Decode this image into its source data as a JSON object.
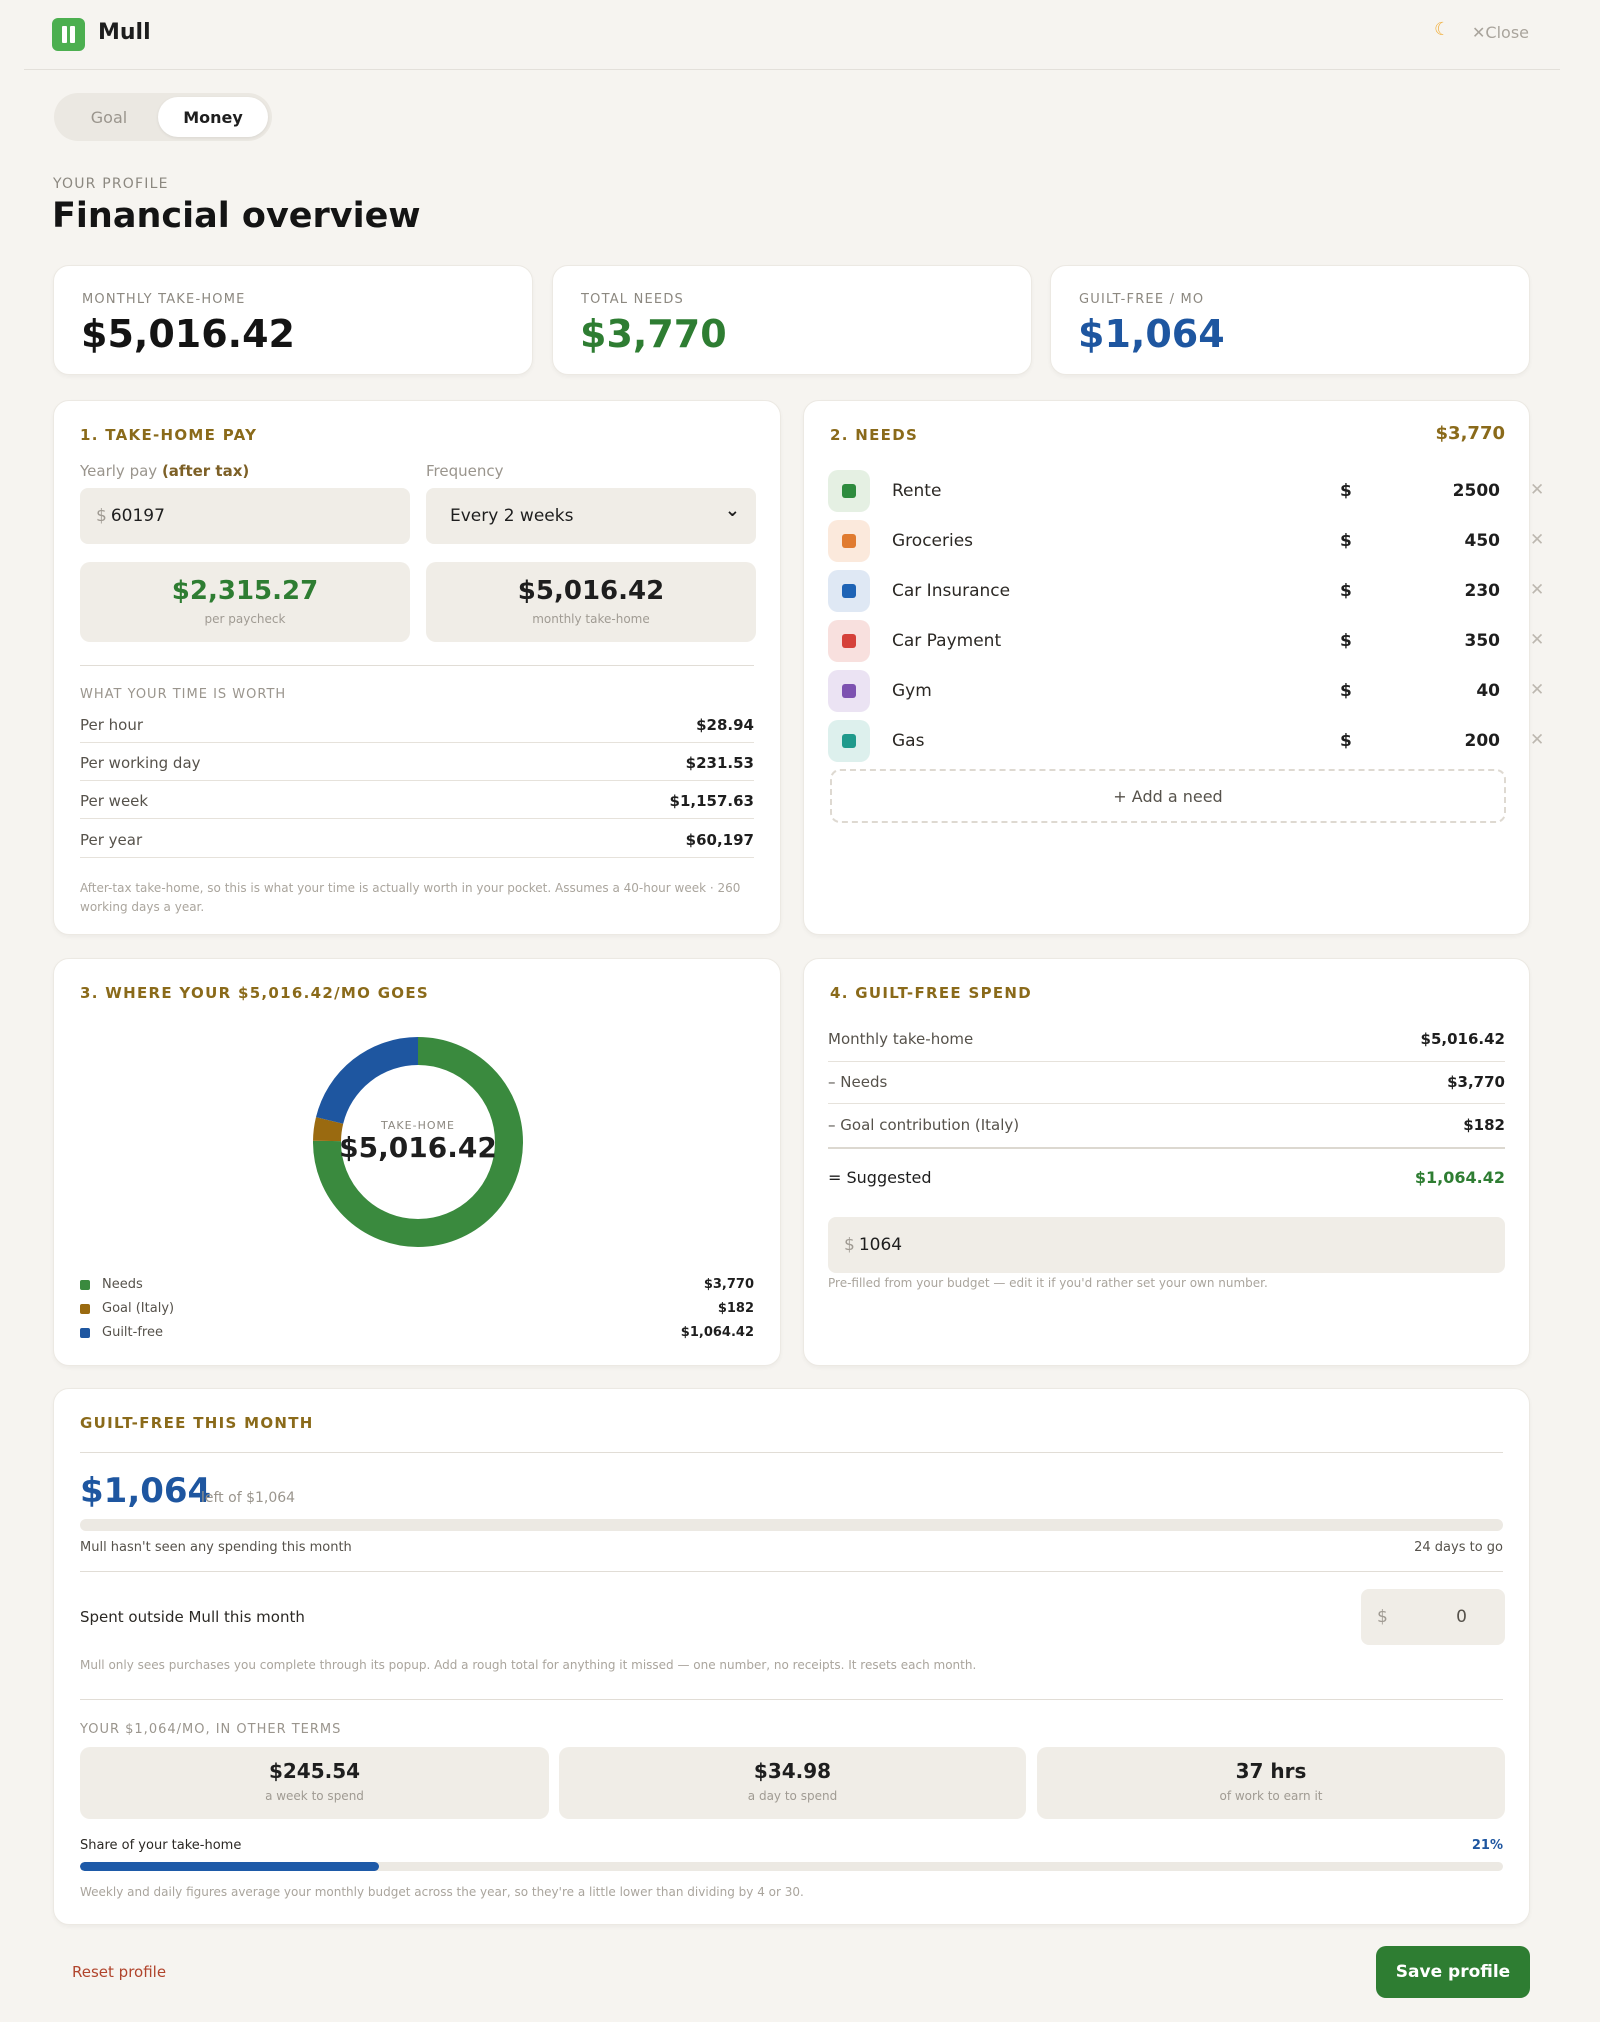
{
  "app": {
    "name": "Mull",
    "close_label": "✕Close",
    "moon_icon": "moon-icon"
  },
  "tabs": [
    {
      "label": "Goal"
    },
    {
      "label": "Money"
    }
  ],
  "header": {
    "eyebrow": "YOUR PROFILE",
    "title": "Financial overview"
  },
  "summary": [
    {
      "label": "MONTHLY TAKE-HOME",
      "value": "$5,016.42",
      "color": "#141414"
    },
    {
      "label": "TOTAL NEEDS",
      "value": "$3,770",
      "color": "#2e7d32"
    },
    {
      "label": "GUILT-FREE / MO",
      "value": "$1,064",
      "color": "#1e56a0"
    }
  ],
  "take_home": {
    "title": "1. TAKE-HOME PAY",
    "yearly_label": "Yearly pay",
    "yearly_suffix": "(after tax)",
    "yearly_prefix": "$",
    "yearly_value": "60197",
    "frequency_label": "Frequency",
    "frequency_value": "Every 2 weeks",
    "per_paycheck": {
      "value": "$2,315.27",
      "label": "per paycheck"
    },
    "monthly": {
      "value": "$5,016.42",
      "label": "monthly take-home"
    },
    "time_title": "WHAT YOUR TIME IS WORTH",
    "time_rows": [
      {
        "label": "Per hour",
        "value": "$28.94"
      },
      {
        "label": "Per working day",
        "value": "$231.53"
      },
      {
        "label": "Per week",
        "value": "$1,157.63"
      },
      {
        "label": "Per year",
        "value": "$60,197"
      }
    ],
    "note": "After-tax take-home, so this is what your time is actually worth in your pocket. Assumes a 40-hour week · 260 working days a year."
  },
  "needs": {
    "title": "2. NEEDS",
    "total": "$3,770",
    "currency": "$",
    "items": [
      {
        "name": "Rente",
        "amount": "2500",
        "color": "#2e8b3e",
        "bg": "#e5f0e3"
      },
      {
        "name": "Groceries",
        "amount": "450",
        "color": "#e07b30",
        "bg": "#fbe9dc"
      },
      {
        "name": "Car Insurance",
        "amount": "230",
        "color": "#1e63b5",
        "bg": "#dfe8f4"
      },
      {
        "name": "Car Payment",
        "amount": "350",
        "color": "#d5413a",
        "bg": "#f8e0de"
      },
      {
        "name": "Gym",
        "amount": "40",
        "color": "#7d52b0",
        "bg": "#ebe3f3"
      },
      {
        "name": "Gas",
        "amount": "200",
        "color": "#1f9a8c",
        "bg": "#ddf0ed"
      }
    ],
    "add_label": "+ Add a need"
  },
  "where": {
    "title": "3. WHERE YOUR $5,016.42/MO GOES",
    "center_label": "TAKE-HOME",
    "center_value": "$5,016.42"
  },
  "chart_data": {
    "type": "pie",
    "categories": [
      "Needs",
      "Goal (Italy)",
      "Guilt-free"
    ],
    "values": [
      3770,
      182,
      1064.42
    ],
    "value_labels": [
      "$3,770",
      "$182",
      "$1,064.42"
    ],
    "colors": [
      "#3a8a3e",
      "#9a6a10",
      "#1e56a0"
    ]
  },
  "guilt_spend": {
    "title": "4. GUILT-FREE SPEND",
    "rows": [
      {
        "label": "Monthly take-home",
        "value": "$5,016.42"
      },
      {
        "label": "– Needs",
        "value": "$3,770"
      },
      {
        "label": "– Goal contribution (Italy)",
        "value": "$182"
      }
    ],
    "suggested_label": "= Suggested",
    "suggested_value": "$1,064.42",
    "input_prefix": "$",
    "input_value": "1064",
    "note": "Pre-filled from your budget — edit it if you'd rather set your own number."
  },
  "month": {
    "title": "GUILT-FREE THIS MONTH",
    "left_value": "$1,064",
    "left_label": "left of $1,064",
    "status": "Mull hasn't seen any spending this month",
    "days_left": "24 days to go",
    "outside_label": "Spent outside Mull this month",
    "outside_prefix": "$",
    "outside_value": "0",
    "outside_note": "Mull only sees purchases you complete through its popup. Add a rough total for anything it missed — one number, no receipts. It resets each month.",
    "terms_title": "YOUR $1,064/MO, IN OTHER TERMS",
    "terms": [
      {
        "value": "$245.54",
        "label": "a week to spend"
      },
      {
        "value": "$34.98",
        "label": "a day to spend"
      },
      {
        "value": "37 hrs",
        "label": "of work to earn it"
      }
    ],
    "share_label": "Share of your take-home",
    "share_value": "21%",
    "share_fraction": 0.21,
    "footnote": "Weekly and daily figures average your monthly budget across the year, so they're a little lower than dividing by 4 or 30."
  },
  "footer": {
    "reset_label": "Reset profile",
    "save_label": "Save profile"
  }
}
